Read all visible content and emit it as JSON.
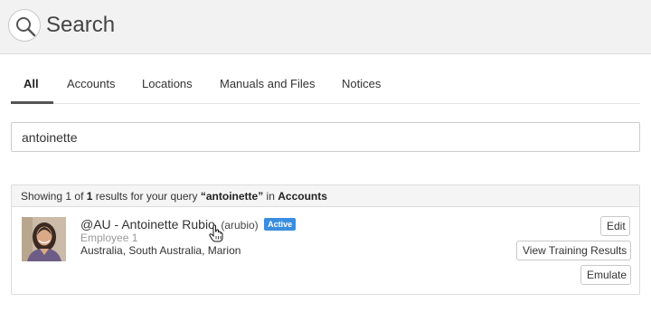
{
  "header": {
    "title": "Search",
    "icon": "search-icon"
  },
  "tabs": [
    {
      "label": "All",
      "active": true
    },
    {
      "label": "Accounts",
      "active": false
    },
    {
      "label": "Locations",
      "active": false
    },
    {
      "label": "Manuals and Files",
      "active": false
    },
    {
      "label": "Notices",
      "active": false
    }
  ],
  "search": {
    "value": "antoinette",
    "placeholder": ""
  },
  "results_summary": {
    "prefix": "Showing",
    "shown": "1",
    "of_word": "of",
    "total": "1",
    "middle": "results for your query",
    "query": "“antoinette”",
    "in_word": "in",
    "scope": "Accounts"
  },
  "result": {
    "name": "@AU - Antoinette Rubio",
    "username": "(arubio)",
    "status": "Active",
    "role": "Employee 1",
    "location": "Australia, South Australia, Marion",
    "actions": {
      "edit": "Edit",
      "training": "View Training Results",
      "emulate": "Emulate"
    }
  },
  "colors": {
    "badge": "#3a8ee0",
    "header_bg": "#f2f2f2",
    "border": "#dcdcdc"
  }
}
